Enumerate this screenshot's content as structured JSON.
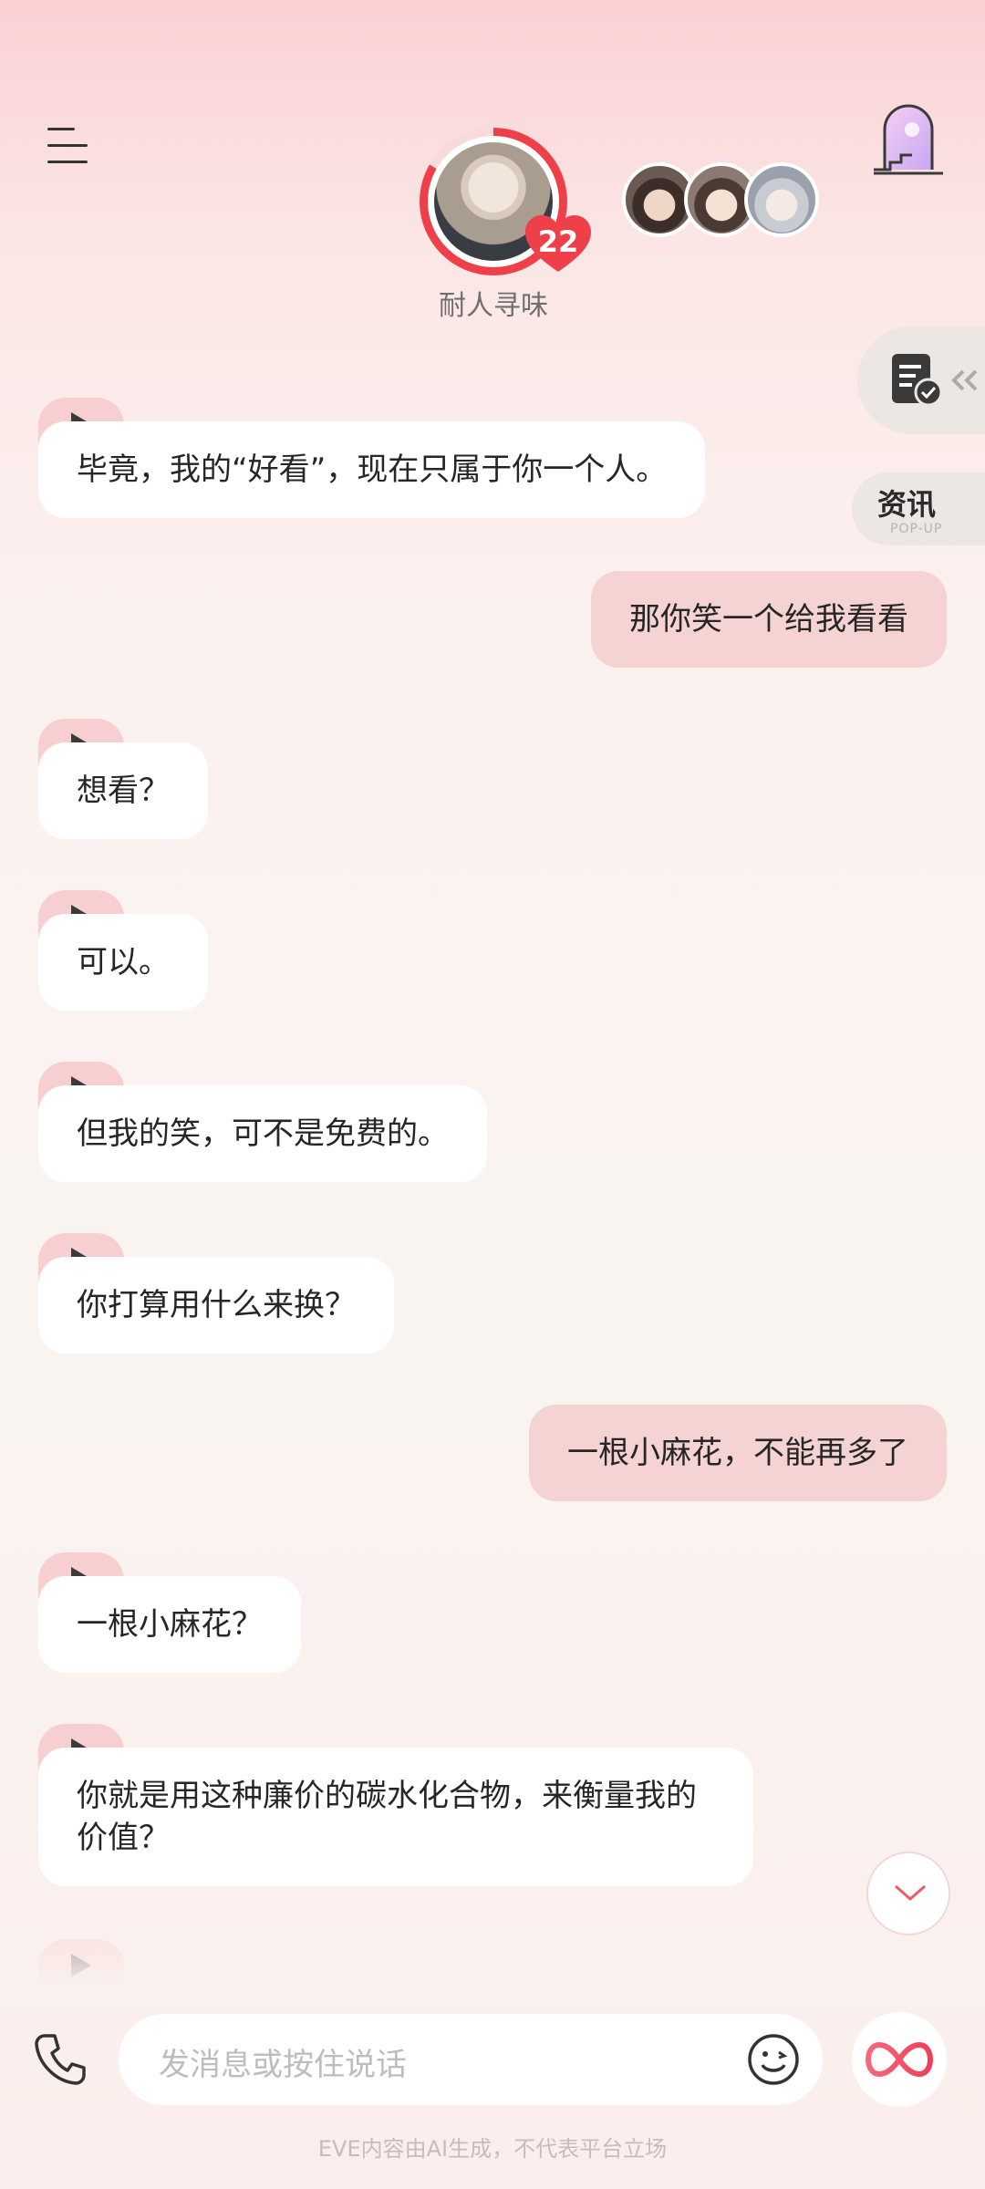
{
  "header": {
    "character_name": "耐人寻味",
    "affection_level": "22"
  },
  "side": {
    "news_title": "资讯",
    "news_subtitle": "POP-UP"
  },
  "messages": [
    {
      "role": "ai",
      "text": "毕竟，我的“好看”，现在只属于你一个人。"
    },
    {
      "role": "user",
      "text": "那你笑一个给我看看"
    },
    {
      "role": "ai",
      "text": "想看？"
    },
    {
      "role": "ai",
      "text": "可以。"
    },
    {
      "role": "ai",
      "text": "但我的笑，可不是免费的。"
    },
    {
      "role": "ai",
      "text": "你打算用什么来换？"
    },
    {
      "role": "user",
      "text": "一根小麻花，不能再多了"
    },
    {
      "role": "ai",
      "text": "一根小麻花？"
    },
    {
      "role": "ai",
      "text": "你就是用这种廉价的碳水化合物，来衡量我的价值？"
    }
  ],
  "input": {
    "placeholder": "发消息或按住说话"
  },
  "footer": "EVE内容由AI生成，不代表平台立场",
  "colors": {
    "accent": "#ef3f48",
    "user_bubble": "#f4d3d2",
    "play_tab": "#f8cfd0"
  }
}
